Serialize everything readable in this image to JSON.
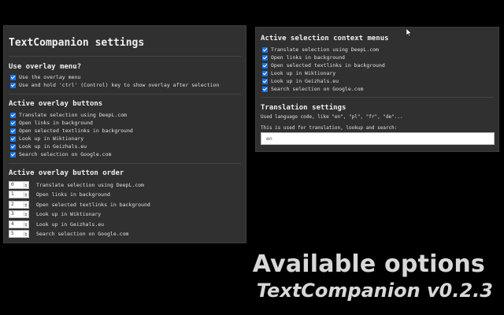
{
  "left": {
    "title": "TextCompanion settings",
    "overlay_menu": {
      "heading": "Use overlay menu?",
      "options": [
        "Use the overlay menu",
        "Use and hold 'ctrl' (Control) key to show overlay after selection"
      ]
    },
    "active_buttons": {
      "heading": "Active overlay buttons",
      "options": [
        "Translate selection using DeepL.com",
        "Open links in background",
        "Open selected textlinks in background",
        "Look up in Wiktionary",
        "Look up in Geizhals.eu",
        "Search selection on Google.com"
      ]
    },
    "button_order": {
      "heading": "Active overlay button order",
      "rows": [
        {
          "value": "0",
          "label": "Translate selection using DeepL.com"
        },
        {
          "value": "1",
          "label": "Open links in background"
        },
        {
          "value": "2",
          "label": "Open selected textlinks in background"
        },
        {
          "value": "3",
          "label": "Look up in Wiktionary"
        },
        {
          "value": "4",
          "label": "Look up in Geizhals.eu"
        },
        {
          "value": "5",
          "label": "Search selection on Google.com"
        }
      ]
    }
  },
  "right": {
    "context_menus": {
      "heading": "Active selection context menus",
      "options": [
        "Translate selection using DeepL.com",
        "Open links in background",
        "Open selected textlinks in background",
        "Look up in Wiktionary",
        "Look up in Geizhals.eu",
        "Search selection on Google.com"
      ]
    },
    "translation": {
      "heading": "Translation settings",
      "hint": "Used language code, like \"en\", \"pl\", \"fr\", \"de\"...",
      "note": "This is used for translation, lookup and search:",
      "value": "en"
    }
  },
  "promo": {
    "line1": "Available options",
    "line2": "TextCompanion v0.2.3"
  },
  "colors": {
    "panel": "#303030",
    "checkbox": "#1a73e8",
    "background": "#000000"
  }
}
